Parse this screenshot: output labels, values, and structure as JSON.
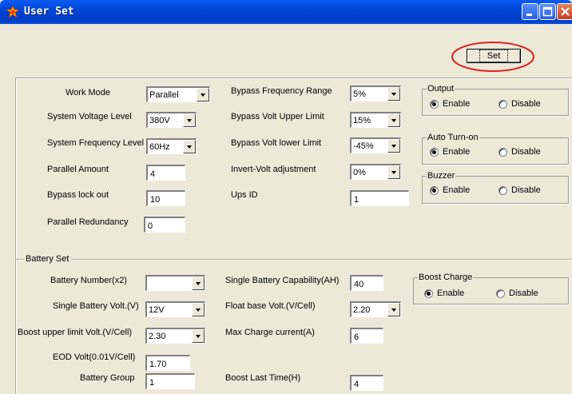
{
  "window": {
    "title": "User Set",
    "controls": [
      "minimize-icon",
      "maximize-icon",
      "close-icon"
    ]
  },
  "set_button": {
    "label": "Set",
    "highlight_color": "#e02020"
  },
  "system": {
    "work_mode": {
      "label": "Work Mode",
      "value": "Parallel"
    },
    "system_voltage_level": {
      "label": "System Voltage Level",
      "value": "380V"
    },
    "system_frequency_level": {
      "label": "System Frequency Level",
      "value": "60Hz"
    },
    "parallel_amount": {
      "label": "Parallel Amount",
      "value": "4"
    },
    "bypass_lock_out": {
      "label": "Bypass lock out",
      "value": "10"
    },
    "parallel_redundancy": {
      "label": "Parallel Redundancy",
      "value": "0"
    },
    "bypass_frequency_range": {
      "label": "Bypass Frequency Range",
      "value": "5%"
    },
    "bypass_volt_upper_limit": {
      "label": "Bypass Volt Upper Limit",
      "value": "15%"
    },
    "bypass_volt_lower_limit": {
      "label": "Bypass Volt lower Limit",
      "value": "-45%"
    },
    "invert_volt_adjustment": {
      "label": "Invert-Volt adjustment",
      "value": "0%"
    },
    "ups_id": {
      "label": "Ups ID",
      "value": "1"
    }
  },
  "groups": {
    "output": {
      "title": "Output",
      "enable": "Enable",
      "disable": "Disable",
      "selected": "Enable"
    },
    "auto_turn_on": {
      "title": "Auto Turn-on",
      "enable": "Enable",
      "disable": "Disable",
      "selected": "Enable"
    },
    "buzzer": {
      "title": "Buzzer",
      "enable": "Enable",
      "disable": "Disable",
      "selected": "Enable"
    }
  },
  "battery": {
    "section_title": "Battery Set",
    "battery_number": {
      "label": "Battery Number(x2)",
      "value": ""
    },
    "single_battery_volt": {
      "label": "Single Battery Volt.(V)",
      "value": "12V"
    },
    "boost_upper_limit_volt": {
      "label": "Boost upper limit Volt.(V/Cell)",
      "value": "2.30"
    },
    "eod_volt": {
      "label": "EOD Volt(0.01V/Cell)",
      "value": "1.70"
    },
    "battery_group": {
      "label": "Battery Group",
      "value": "1"
    },
    "single_battery_capability": {
      "label": "Single Battery Capability(AH)",
      "value": "40"
    },
    "float_base_volt": {
      "label": "Float base Volt.(V/Cell)",
      "value": "2.20"
    },
    "max_charge_current": {
      "label": "Max Charge current(A)",
      "value": "6"
    },
    "boost_last_time": {
      "label": "Boost Last Time(H)",
      "value": "4"
    },
    "boost_charge": {
      "title": "Boost Charge",
      "enable": "Enable",
      "disable": "Disable",
      "selected": "Enable"
    }
  }
}
